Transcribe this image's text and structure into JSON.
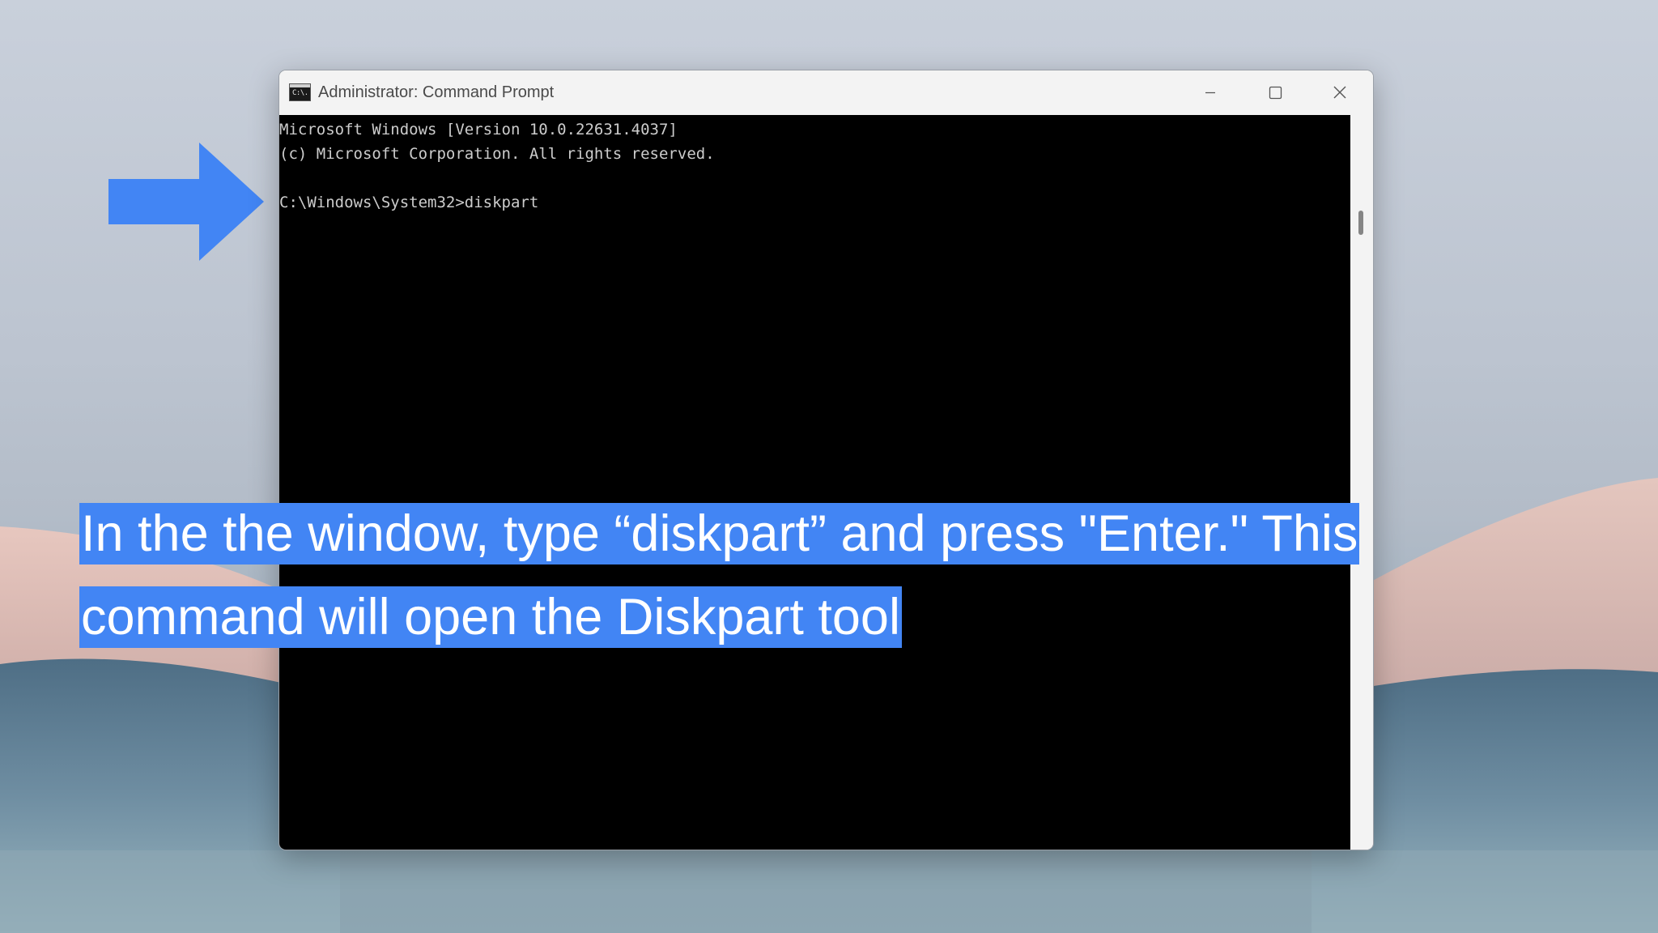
{
  "window": {
    "title": "Administrator: Command Prompt",
    "app_icon_text": "C:\\.",
    "controls": {
      "minimize": "minimize",
      "maximize": "maximize",
      "close": "close"
    }
  },
  "console": {
    "lines": [
      "Microsoft Windows [Version 10.0.22631.4037]",
      "(c) Microsoft Corporation. All rights reserved.",
      "",
      "C:\\Windows\\System32>diskpart"
    ]
  },
  "caption": {
    "line1": "In the the window, type “diskpart” and press \"Enter.\" This",
    "line2": "command will open the Diskpart tool"
  },
  "colors": {
    "highlight": "#4285f4",
    "arrow": "#4285f4",
    "console_bg": "#000000",
    "console_text": "#cccccc",
    "titlebar": "#f3f3f3"
  },
  "icons": {
    "app": "command-prompt-icon",
    "annotation": "right-arrow-icon"
  }
}
